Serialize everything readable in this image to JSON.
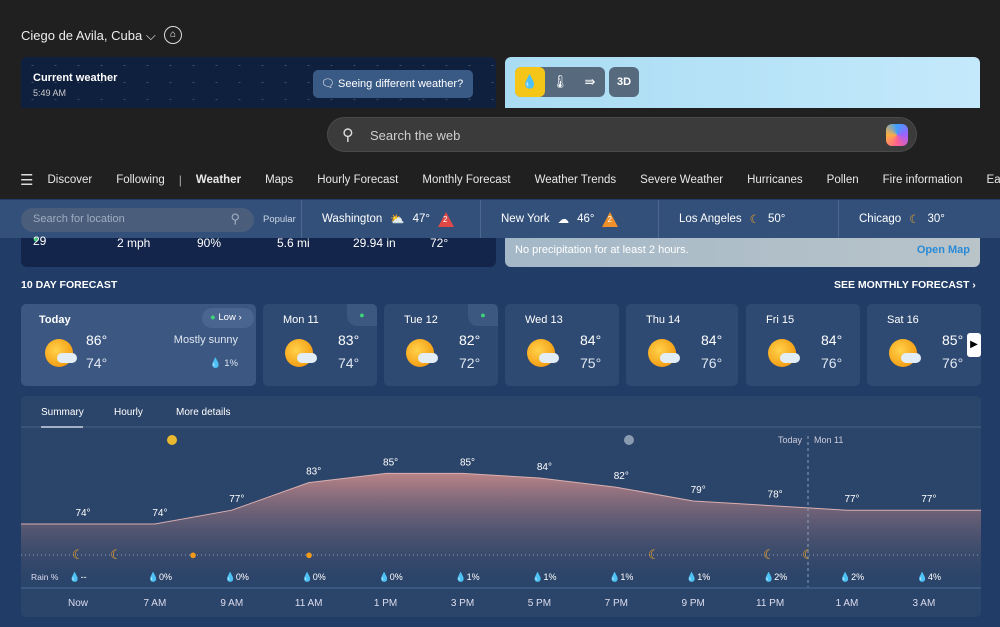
{
  "header": {
    "location": "Ciego de Avila, Cuba",
    "home_icon": "home-icon"
  },
  "current": {
    "title": "Current weather",
    "time": "5:49 AM",
    "feedback": "Seeing different weather?",
    "stats": [
      "29",
      "2 mph",
      "90%",
      "5.6 mi",
      "29.94 in",
      "72°"
    ]
  },
  "map": {
    "layers": [
      "precipitation",
      "temperature",
      "wind"
    ],
    "active": "precipitation",
    "btn3d": "3D",
    "status": "No precipitation for at least 2 hours.",
    "open": "Open Map"
  },
  "search": {
    "placeholder": "Search the web"
  },
  "nav": {
    "items": [
      "Discover",
      "Following",
      "Weather",
      "Maps",
      "Hourly Forecast",
      "Monthly Forecast",
      "Weather Trends",
      "Severe Weather",
      "Hurricanes",
      "Pollen",
      "Fire information",
      "Earthquake"
    ],
    "active": "Weather"
  },
  "popular": {
    "search_placeholder": "Search for location",
    "label": "Popular",
    "cities": [
      {
        "name": "Washington",
        "temp": "47°",
        "alert": "2",
        "alert_color": "#e04848"
      },
      {
        "name": "New York",
        "temp": "46°",
        "alert": "2",
        "alert_color": "#f0902a"
      },
      {
        "name": "Los Angeles",
        "temp": "50°"
      },
      {
        "name": "Chicago",
        "temp": "30°"
      }
    ]
  },
  "forecast": {
    "title": "10 DAY FORECAST",
    "monthly": "SEE MONTHLY FORECAST ›",
    "today": {
      "name": "Today",
      "hi": "86°",
      "lo": "74°",
      "cond": "Mostly sunny",
      "rain": "1%",
      "pollen": "Low"
    },
    "days": [
      {
        "name": "Mon 11",
        "hi": "83°",
        "lo": "74°"
      },
      {
        "name": "Tue 12",
        "hi": "82°",
        "lo": "72°"
      },
      {
        "name": "Wed 13",
        "hi": "84°",
        "lo": "75°"
      },
      {
        "name": "Thu 14",
        "hi": "84°",
        "lo": "76°"
      },
      {
        "name": "Fri 15",
        "hi": "84°",
        "lo": "76°"
      },
      {
        "name": "Sat 16",
        "hi": "85°",
        "lo": "76°"
      }
    ]
  },
  "hourly": {
    "tabs": [
      "Summary",
      "Hourly",
      "More details"
    ],
    "active_tab": "Summary",
    "today_label": "Today",
    "next_label": "Mon 11",
    "rain_label": "Rain %",
    "times": [
      "Now",
      "7 AM",
      "9 AM",
      "11 AM",
      "1 PM",
      "3 PM",
      "5 PM",
      "7 PM",
      "9 PM",
      "11 PM",
      "1 AM",
      "3 AM"
    ],
    "temps": [
      74,
      74,
      77,
      83,
      85,
      85,
      84,
      82,
      79,
      78,
      77,
      77
    ],
    "rain": [
      "--",
      "0%",
      "0%",
      "0%",
      "0%",
      "1%",
      "1%",
      "1%",
      "1%",
      "2%",
      "2%",
      "4%"
    ]
  }
}
